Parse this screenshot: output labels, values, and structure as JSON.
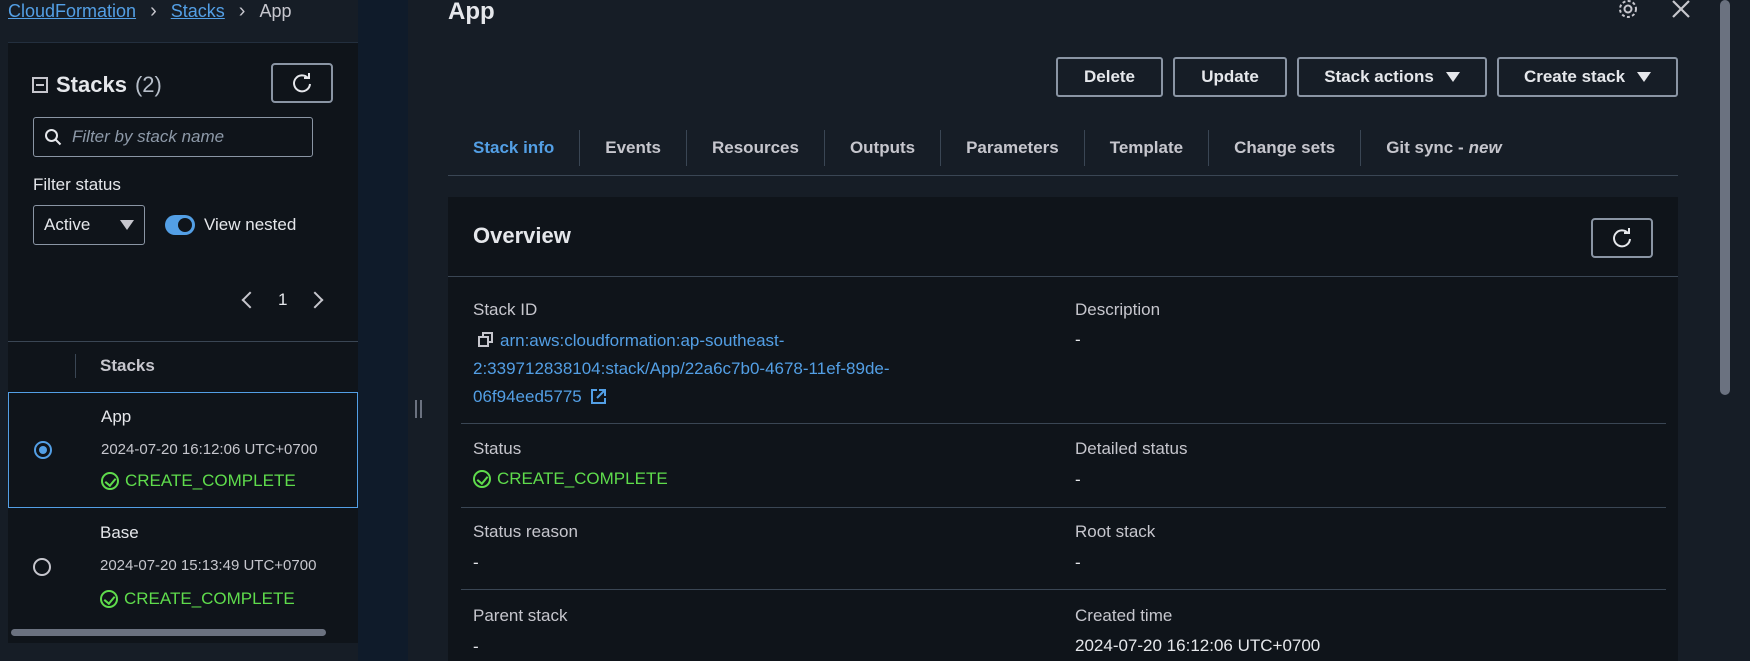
{
  "breadcrumb": [
    "CloudFormation",
    "Stacks",
    "App"
  ],
  "stacks_panel": {
    "title": "Stacks",
    "count": "(2)",
    "search_placeholder": "Filter by stack name",
    "filter_label": "Filter status",
    "filter_value": "Active",
    "view_nested_label": "View nested",
    "view_nested_on": true,
    "page": "1",
    "column_header": "Stacks",
    "rows": [
      {
        "name": "App",
        "date": "2024-07-20 16:12:06 UTC+0700",
        "status": "CREATE_COMPLETE",
        "selected": true
      },
      {
        "name": "Base",
        "date": "2024-07-20 15:13:49 UTC+0700",
        "status": "CREATE_COMPLETE",
        "selected": false
      }
    ]
  },
  "detail": {
    "title": "App",
    "buttons": {
      "delete": "Delete",
      "update": "Update",
      "stack_actions": "Stack actions",
      "create_stack": "Create stack"
    },
    "tabs": [
      "Stack info",
      "Events",
      "Resources",
      "Outputs",
      "Parameters",
      "Template",
      "Change sets",
      "Git sync -"
    ],
    "tab_new_badge": "new",
    "active_tab": "Stack info",
    "overview": {
      "title": "Overview",
      "stack_id_label": "Stack ID",
      "stack_id_line1": "arn:aws:cloudformation:ap-southeast-",
      "stack_id_line2": "2:339712838104:stack/App/22a6c7b0-4678-11ef-89de-",
      "stack_id_line3": "06f94eed5775",
      "description_label": "Description",
      "description_value": "-",
      "status_label": "Status",
      "status_value": "CREATE_COMPLETE",
      "detailed_status_label": "Detailed status",
      "detailed_status_value": "-",
      "status_reason_label": "Status reason",
      "status_reason_value": "-",
      "root_stack_label": "Root stack",
      "root_stack_value": "-",
      "parent_stack_label": "Parent stack",
      "parent_stack_value": "-",
      "created_time_label": "Created time",
      "created_time_value": "2024-07-20 16:12:06 UTC+0700"
    }
  },
  "colors": {
    "accent": "#539fe5",
    "success": "#5fdc4c",
    "background": "#0f141a",
    "border": "#8a95a4"
  },
  "icons": [
    "collapse-icon",
    "refresh-icon",
    "search-icon",
    "chevron-left-icon",
    "chevron-right-icon",
    "check-circle-icon",
    "radio-icon",
    "copy-icon",
    "external-link-icon",
    "gear-icon",
    "close-icon",
    "caret-down-icon"
  ]
}
